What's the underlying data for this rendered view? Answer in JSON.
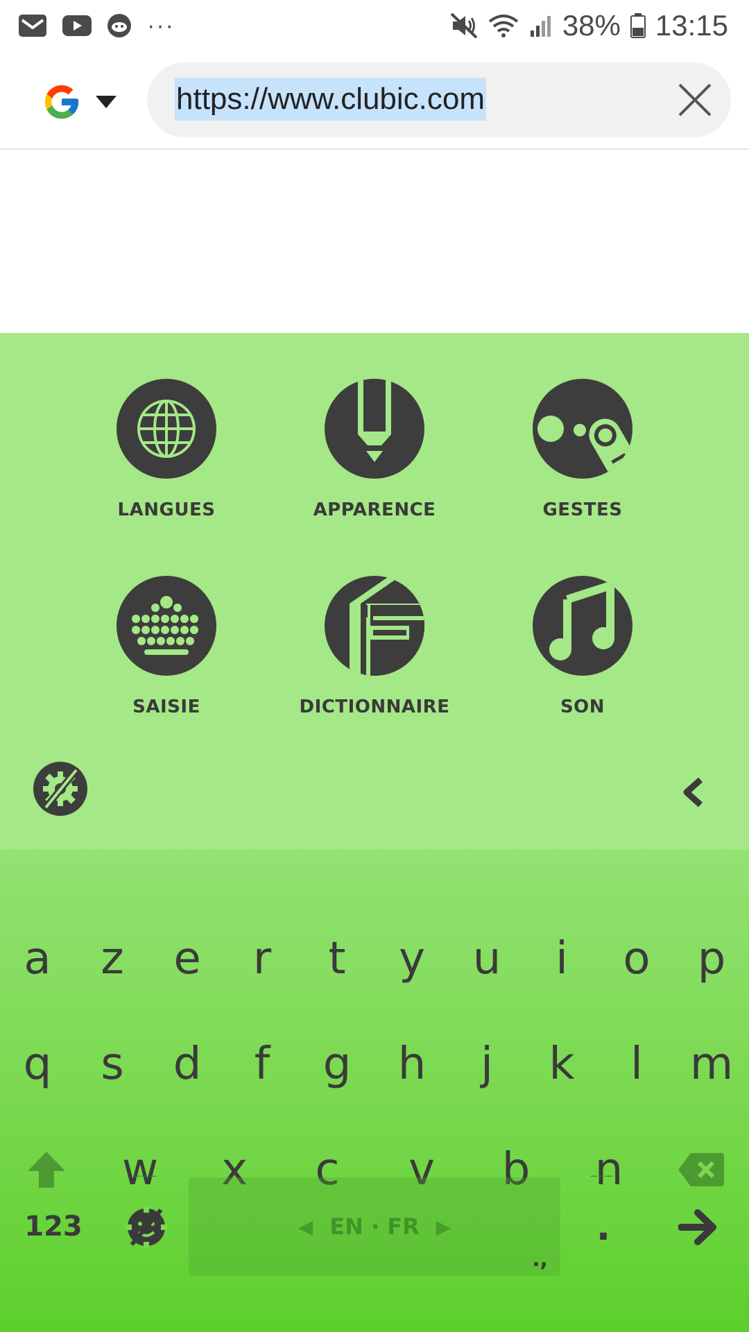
{
  "status_bar": {
    "battery": "38%",
    "time": "13:15",
    "icons": [
      "mail-icon",
      "youtube-icon",
      "reddit-icon",
      "more-icon",
      "mute-icon",
      "wifi-icon",
      "signal-icon",
      "battery-icon"
    ]
  },
  "url_bar": {
    "url": "https://www.clubic.com",
    "engine": "google-g-icon"
  },
  "panel": {
    "tiles": [
      {
        "label": "LANGUES",
        "icon": "globe-icon"
      },
      {
        "label": "APPARENCE",
        "icon": "brush-icon"
      },
      {
        "label": "GESTES",
        "icon": "gesture-icon"
      },
      {
        "label": "SAISIE",
        "icon": "keyboard-icon"
      },
      {
        "label": "DICTIONNAIRE",
        "icon": "book-icon"
      },
      {
        "label": "SON",
        "icon": "music-note-icon"
      }
    ]
  },
  "keyboard": {
    "row1": [
      "a",
      "z",
      "e",
      "r",
      "t",
      "y",
      "u",
      "i",
      "o",
      "p"
    ],
    "row2": [
      "q",
      "s",
      "d",
      "f",
      "g",
      "h",
      "j",
      "k",
      "l",
      "m"
    ],
    "row3": [
      "w",
      "x",
      "c",
      "v",
      "b",
      "n"
    ],
    "num_label": "123",
    "space_label": "EN · FR",
    "space_hint": ".,",
    "period": "."
  },
  "colors": {
    "panel_bg": "#a5e887",
    "keyboard_top": "#93e273",
    "keyboard_bottom": "#5ccf2c",
    "icon_dark": "#3d3d3d",
    "url_selection": "#c6e3fb"
  }
}
